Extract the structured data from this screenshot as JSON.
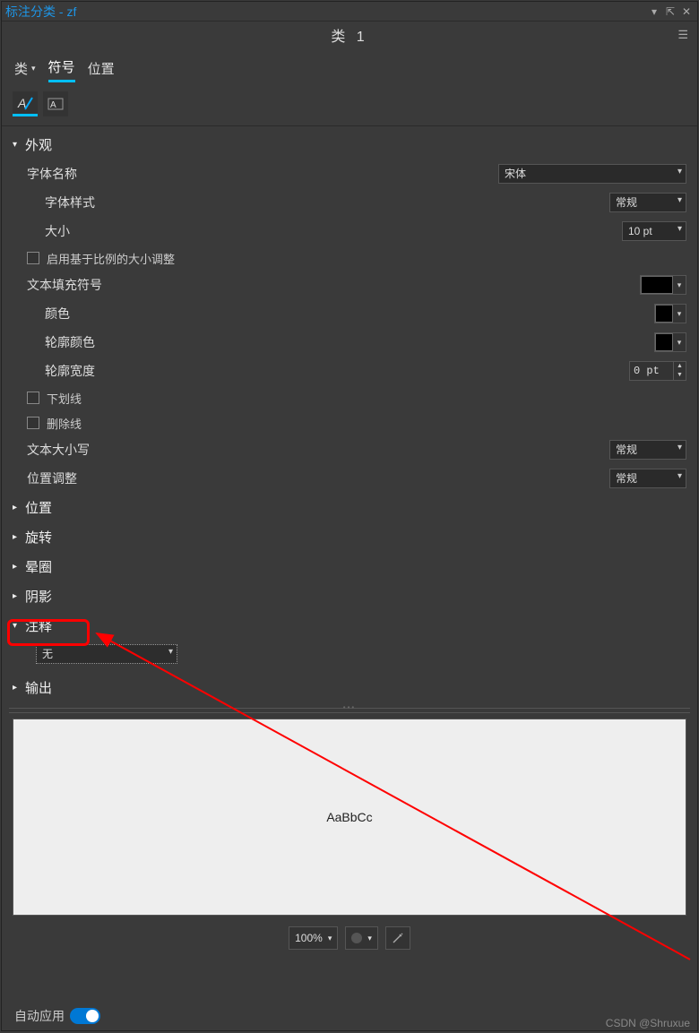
{
  "window": {
    "title": "标注分类 - zf",
    "subtitle": "类 1"
  },
  "tabs": {
    "t0": "类",
    "t1": "符号",
    "t2": "位置"
  },
  "sections": {
    "appearance": "外观",
    "position": "位置",
    "rotation": "旋转",
    "halo": "晕圈",
    "shadow": "阴影",
    "notes": "注释",
    "output": "输出"
  },
  "labels": {
    "font_name": "字体名称",
    "font_style": "字体样式",
    "size": "大小",
    "scale_cb": "启用基于比例的大小调整",
    "text_fill": "文本填充符号",
    "color": "颜色",
    "outline_color": "轮廓颜色",
    "outline_width": "轮廓宽度",
    "underline": "下划线",
    "strike": "删除线",
    "text_case": "文本大小写",
    "pos_adj": "位置调整"
  },
  "values": {
    "font_name": "宋体",
    "font_style": "常规",
    "size": "10 pt",
    "outline_width": "0 pt",
    "text_case": "常规",
    "pos_adj": "常规",
    "notes_sel": "无",
    "zoom": "100%",
    "preview_text": "AaBbCc"
  },
  "footer": {
    "auto_apply": "自动应用"
  },
  "watermark": "CSDN @Shruxue"
}
